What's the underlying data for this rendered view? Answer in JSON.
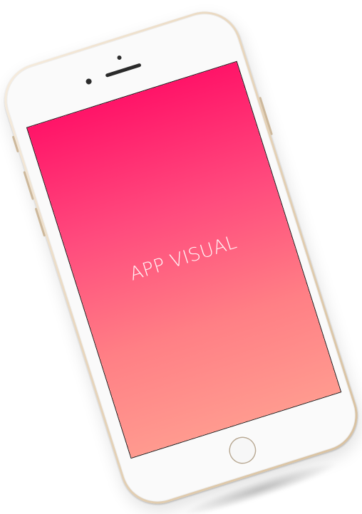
{
  "screen": {
    "title": "APP VISUAL"
  },
  "device": {
    "frame_color": "#e8d6bd",
    "face_color": "#fafafa",
    "screen_gradient": [
      "#ff1468",
      "#ff4a7d",
      "#ff7f85",
      "#ff9a8f"
    ]
  }
}
